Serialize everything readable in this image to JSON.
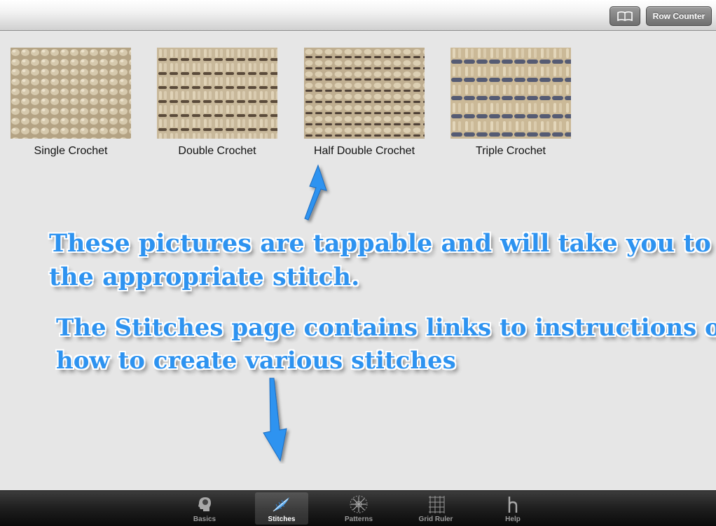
{
  "navbar": {
    "book_icon": "book-icon",
    "row_counter_label": "Row Counter"
  },
  "stitches": [
    {
      "label": "Single Crochet"
    },
    {
      "label": "Double Crochet"
    },
    {
      "label": "Half Double Crochet"
    },
    {
      "label": "Triple Crochet"
    }
  ],
  "annotations": {
    "pictures_line1": "These pictures are tappable and will take you to",
    "pictures_line2": "the appropriate stitch.",
    "page_line1": "The Stitches page contains links to instructions on",
    "page_line2": "how to create various stitches"
  },
  "tabs": [
    {
      "label": "Basics",
      "icon": "head-icon"
    },
    {
      "label": "Stitches",
      "icon": "feather-icon",
      "active": true
    },
    {
      "label": "Patterns",
      "icon": "snowflake-pattern-icon"
    },
    {
      "label": "Grid Ruler",
      "icon": "grid-ruler-icon"
    },
    {
      "label": "Help",
      "icon": "help-h-icon"
    }
  ],
  "colors": {
    "annotation_text": "#2e93f0",
    "arrow": "#2e93f0",
    "background": "#e6e6e6"
  }
}
